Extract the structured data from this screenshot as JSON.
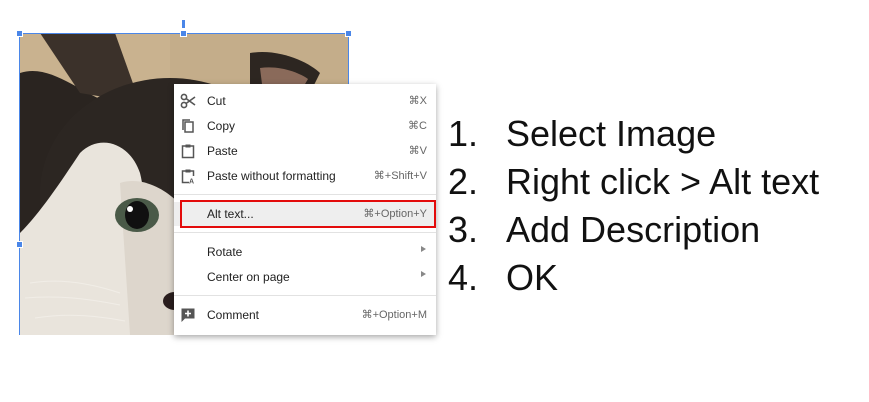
{
  "image": {
    "alt": "Cat photo"
  },
  "context_menu": {
    "items": [
      {
        "label": "Cut",
        "shortcut": "⌘X",
        "icon": "scissors-icon"
      },
      {
        "label": "Copy",
        "shortcut": "⌘C",
        "icon": "copy-icon"
      },
      {
        "label": "Paste",
        "shortcut": "⌘V",
        "icon": "clipboard-icon"
      },
      {
        "label": "Paste without formatting",
        "shortcut": "⌘+Shift+V",
        "icon": "paste-plain-icon"
      },
      {
        "label": "Alt text...",
        "shortcut": "⌘+Option+Y",
        "highlighted": true
      },
      {
        "label": "Rotate",
        "submenu": true
      },
      {
        "label": "Center on page",
        "submenu": true
      },
      {
        "label": "Comment",
        "shortcut": "⌘+Option+M",
        "icon": "add-comment-icon"
      }
    ],
    "highlight_color": "#e30b0b"
  },
  "steps": [
    {
      "num": "1.",
      "text": "Select Image"
    },
    {
      "num": "2.",
      "text": "Right click > Alt text"
    },
    {
      "num": "3.",
      "text": "Add Description"
    },
    {
      "num": "4.",
      "text": "OK"
    }
  ],
  "colors": {
    "selection": "#4a86e8",
    "highlight_border": "#e30b0b"
  }
}
